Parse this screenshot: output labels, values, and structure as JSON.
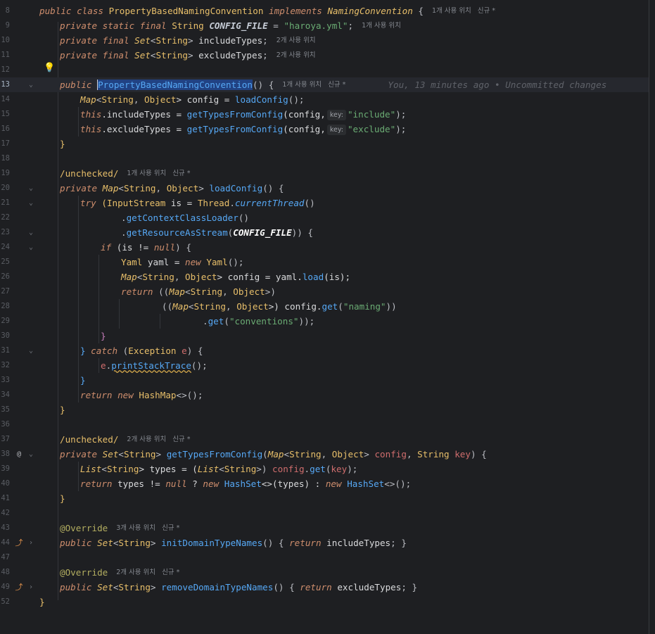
{
  "bulb_icon": "lightbulb-icon",
  "blame": "You, 13 minutes ago • Uncommitted changes",
  "lines": {
    "l8": {
      "num": "8",
      "p": [
        "public class ",
        "PropertyBasedNamingConvention",
        " implements ",
        "NamingConvention",
        " {"
      ],
      "hint": "1개 사용 위치   신규 *"
    },
    "l9": {
      "num": "9",
      "p": [
        "private static final ",
        "String ",
        "CONFIG_FILE",
        " = ",
        "\"haroya.yml\"",
        ";"
      ],
      "hint": "1개 사용 위치"
    },
    "l10": {
      "num": "10",
      "p": [
        "private final ",
        "Set",
        "<",
        "String",
        "> ",
        "includeTypes",
        ";"
      ],
      "hint": "2개 사용 위치"
    },
    "l11": {
      "num": "11",
      "p": [
        "private final ",
        "Set",
        "<",
        "String",
        "> ",
        "excludeTypes",
        ";"
      ],
      "hint": "2개 사용 위치"
    },
    "l12": {
      "num": "12"
    },
    "l13": {
      "num": "13",
      "p": [
        "public ",
        "PropertyBasedNamingConvention",
        "() {"
      ],
      "hint": "1개 사용 위치   신규 *"
    },
    "l14": {
      "num": "14",
      "p": [
        "Map",
        "<",
        "String",
        ", ",
        "Object",
        "> config = ",
        "loadConfig",
        "();"
      ]
    },
    "l15": {
      "num": "15",
      "p": [
        "this",
        ".includeTypes = ",
        "getTypesFromConfig",
        "(config,",
        "key:",
        "\"include\"",
        ");"
      ]
    },
    "l16": {
      "num": "16",
      "p": [
        "this",
        ".excludeTypes = ",
        "getTypesFromConfig",
        "(config,",
        "key:",
        "\"exclude\"",
        ");"
      ]
    },
    "l17": {
      "num": "17",
      "p": [
        "}"
      ]
    },
    "l18": {
      "num": "18"
    },
    "l19": {
      "num": "19",
      "p": [
        "/unchecked/"
      ],
      "hint": "1개 사용 위치   신규 *"
    },
    "l20": {
      "num": "20",
      "p": [
        "private ",
        "Map",
        "<",
        "String",
        ", ",
        "Object",
        "> ",
        "loadConfig",
        "() {"
      ]
    },
    "l21": {
      "num": "21",
      "p": [
        "try ",
        "(",
        "InputStream",
        " is = ",
        "Thread",
        ".",
        "currentThread",
        "()"
      ]
    },
    "l22": {
      "num": "22",
      "p": [
        ".",
        "getContextClassLoader",
        "()"
      ]
    },
    "l23": {
      "num": "23",
      "p": [
        ".",
        "getResourceAsStream",
        "(",
        "CONFIG_FILE",
        ")) {"
      ]
    },
    "l24": {
      "num": "24",
      "p": [
        "if ",
        "(is != ",
        "null",
        ") {"
      ]
    },
    "l25": {
      "num": "25",
      "p": [
        "Yaml",
        " yaml = ",
        "new ",
        "Yaml",
        "();"
      ]
    },
    "l26": {
      "num": "26",
      "p": [
        "Map",
        "<",
        "String",
        ", ",
        "Object",
        "> config = yaml.",
        "load",
        "(is);"
      ]
    },
    "l27": {
      "num": "27",
      "p": [
        "return ",
        "((",
        "Map",
        "<",
        "String",
        ", ",
        "Object",
        ">)"
      ]
    },
    "l28": {
      "num": "28",
      "p": [
        "((",
        "Map",
        "<",
        "String",
        ", ",
        "Object",
        ">) config.",
        "get",
        "(",
        "\"naming\"",
        "))"
      ]
    },
    "l29": {
      "num": "29",
      "p": [
        ".",
        "get",
        "(",
        "\"conventions\"",
        "));"
      ]
    },
    "l30": {
      "num": "30",
      "p": [
        "}"
      ]
    },
    "l31": {
      "num": "31",
      "p": [
        "} ",
        "catch ",
        "(",
        "Exception",
        " ",
        "e",
        ") {"
      ]
    },
    "l32": {
      "num": "32",
      "p": [
        "e",
        ".",
        "printStackTrace",
        "();"
      ]
    },
    "l33": {
      "num": "33",
      "p": [
        "}"
      ]
    },
    "l34": {
      "num": "34",
      "p": [
        "return new ",
        "HashMap",
        "<>();"
      ]
    },
    "l35": {
      "num": "35",
      "p": [
        "}"
      ]
    },
    "l36": {
      "num": "36"
    },
    "l37": {
      "num": "37",
      "p": [
        "/unchecked/"
      ],
      "hint": "2개 사용 위치   신규 *"
    },
    "l38": {
      "num": "38",
      "p": [
        "private ",
        "Set",
        "<",
        "String",
        "> ",
        "getTypesFromConfig",
        "(",
        "Map",
        "<",
        "String",
        ", ",
        "Object",
        "> ",
        "config",
        ", ",
        "String",
        " ",
        "key",
        ") {"
      ]
    },
    "l39": {
      "num": "39",
      "p": [
        "List",
        "<",
        "String",
        "> types = (",
        "List",
        "<",
        "String",
        ">) ",
        "config",
        ".",
        "get",
        "(",
        "key",
        ");"
      ]
    },
    "l40": {
      "num": "40",
      "p": [
        "return ",
        "types != ",
        "null",
        " ? ",
        "new ",
        "HashSet",
        "<>(types) : ",
        "new ",
        "HashSet",
        "<>();"
      ]
    },
    "l41": {
      "num": "41",
      "p": [
        "}"
      ]
    },
    "l42": {
      "num": "42"
    },
    "l43": {
      "num": "43",
      "p": [
        "@Override"
      ],
      "hint": "3개 사용 위치   신규 *"
    },
    "l44": {
      "num": "44",
      "p": [
        "public ",
        "Set",
        "<",
        "String",
        "> ",
        "initDomainTypeNames",
        "() { ",
        "return ",
        "includeTypes",
        "; }"
      ]
    },
    "l47": {
      "num": "47"
    },
    "l48": {
      "num": "48",
      "p": [
        "@Override"
      ],
      "hint": "2개 사용 위치   신규 *"
    },
    "l49": {
      "num": "49",
      "p": [
        "public ",
        "Set",
        "<",
        "String",
        "> ",
        "removeDomainTypeNames",
        "() { ",
        "return ",
        "excludeTypes",
        "; }"
      ]
    },
    "l52": {
      "num": "52",
      "p": [
        "}"
      ]
    }
  }
}
